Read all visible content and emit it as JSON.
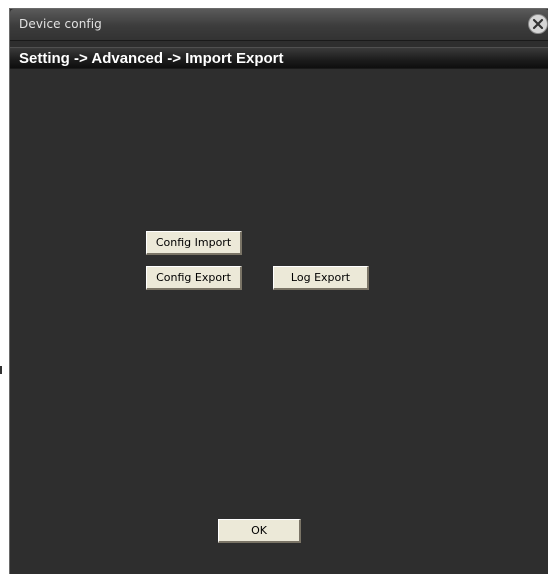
{
  "window": {
    "title": "Device config",
    "close_icon": "close-icon"
  },
  "breadcrumb": {
    "text": "Setting -> Advanced -> Import Export"
  },
  "buttons": {
    "config_import": "Config Import",
    "config_export": "Config Export",
    "log_export": "Log Export",
    "ok": "OK"
  },
  "colors": {
    "background": "#2e2e2e",
    "button_face": "#ece9d8",
    "title_text": "#e2e2e2",
    "breadcrumb_text": "#ffffff"
  }
}
